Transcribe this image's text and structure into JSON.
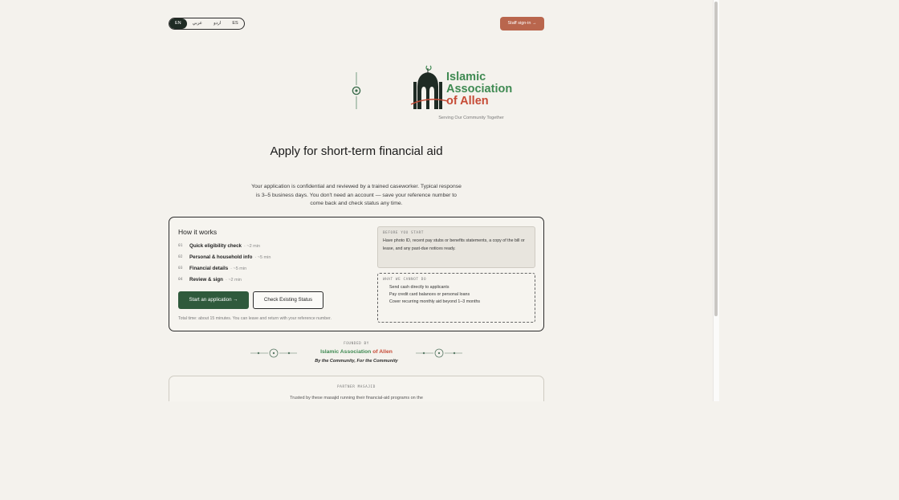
{
  "languages": [
    {
      "label": "EN",
      "active": true
    },
    {
      "label": "عربي"
    },
    {
      "label": "اردو"
    },
    {
      "label": "ES"
    }
  ],
  "header": {
    "staff_signin": "Staff sign-in →"
  },
  "logo": {
    "line1": "Islamic",
    "line2": "Association",
    "line3": "of Allen",
    "tagline": "Serving Our Community Together"
  },
  "hero": {
    "title": "Apply for short-term financial aid",
    "intro": "Your application is confidential and reviewed by a trained caseworker. Typical response is 3–5 business days. You don't need an account — save your reference number to come back and check status any time."
  },
  "how": {
    "title": "How it works",
    "steps": [
      {
        "num": "01",
        "name": "Quick eligibility check",
        "dur": "· ~2 min"
      },
      {
        "num": "02",
        "name": "Personal & household info",
        "dur": "· ~5 min"
      },
      {
        "num": "03",
        "name": "Financial details",
        "dur": "· ~5 min"
      },
      {
        "num": "04",
        "name": "Review & sign",
        "dur": "· ~2 min"
      }
    ],
    "start_button": "Start an application →",
    "check_button": "Check Existing Status",
    "total": "Total time: about 15 minutes. You can leave and return with your reference number."
  },
  "before": {
    "caption": "BEFORE YOU START",
    "text": "Have photo ID, recent pay stubs or benefits statements, a copy of the bill or lease, and any past-due notices ready."
  },
  "cannot": {
    "caption": "WHAT WE CANNOT DO",
    "items": [
      "Send cash directly to applicants",
      "Pay credit card balances or personal loans",
      "Cover recurring monthly aid beyond 1–3 months"
    ]
  },
  "founded": {
    "caption": "FOUNDED BY",
    "name_green": "Islamic Association ",
    "name_of": "of ",
    "name_allen": "Allen",
    "tagline": "By the Community, For the Community"
  },
  "partner": {
    "caption": "PARTNER MASAJID",
    "text": "Trusted by these masajid running their financial-aid programs on the"
  },
  "colors": {
    "accent_green": "#2f5a3c",
    "brand_green": "#3f8a52",
    "brand_red": "#c64b36",
    "staff_button": "#b9664d"
  }
}
